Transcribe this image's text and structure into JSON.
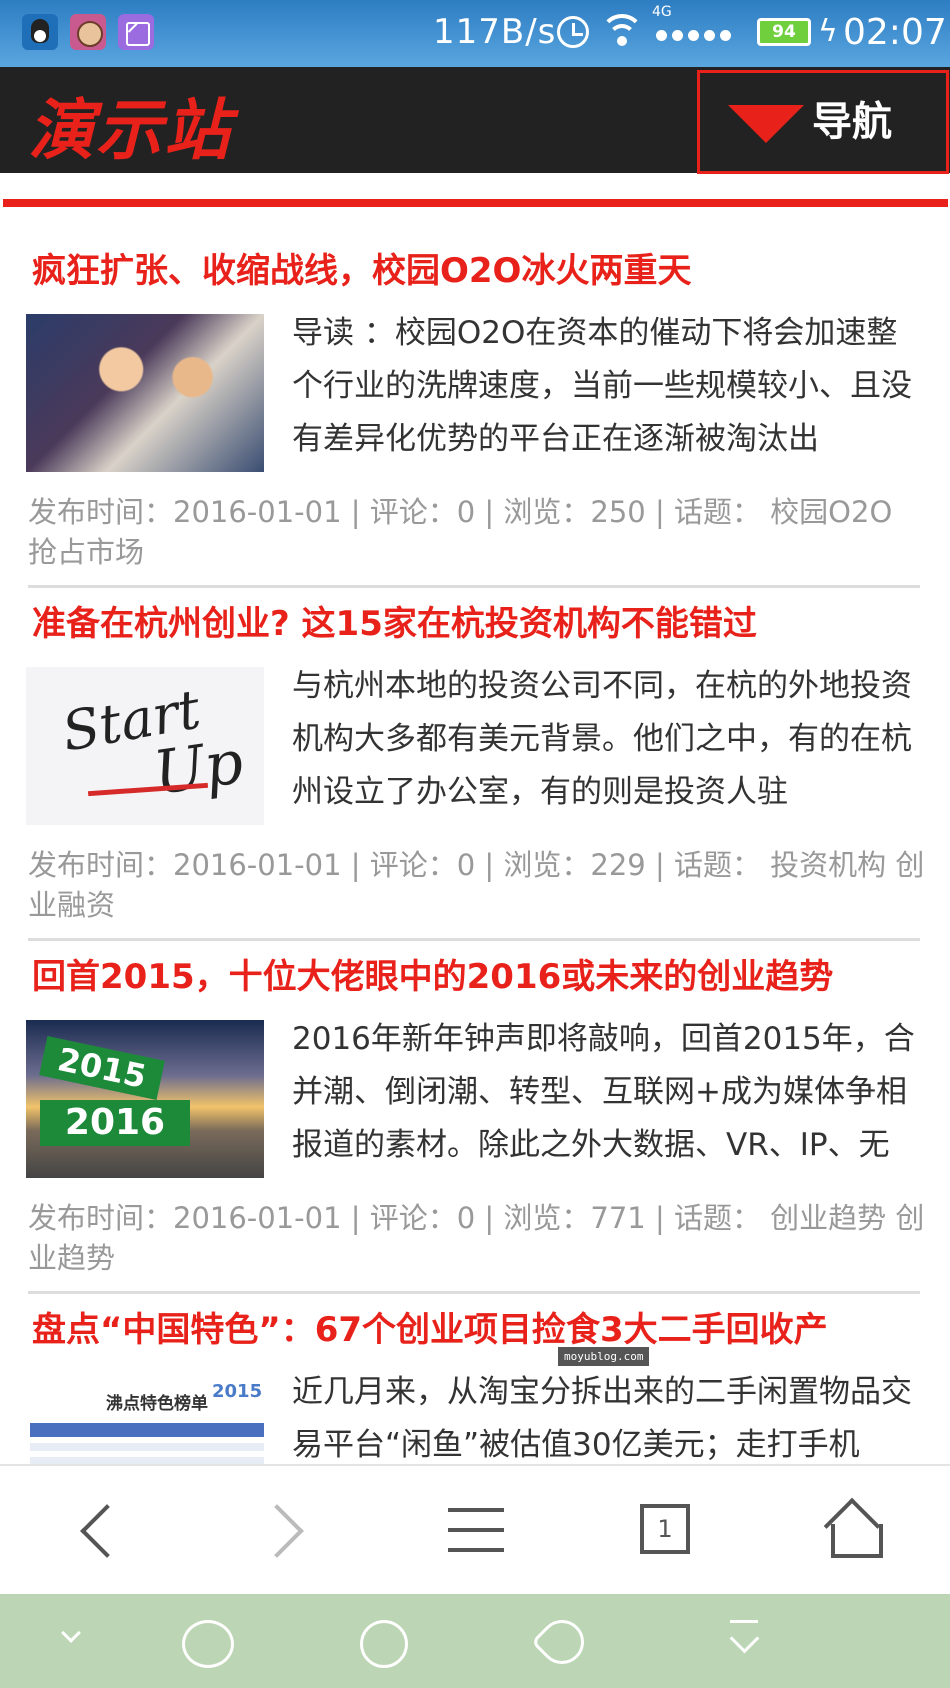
{
  "status_bar": {
    "speed": "117B/s",
    "network": "4G",
    "battery": "94",
    "time": "02:07",
    "icons": [
      "qq-icon",
      "pet-app-icon",
      "gallery-icon",
      "alarm-icon",
      "wifi-icon",
      "signal-icon",
      "battery-icon",
      "charging-icon"
    ]
  },
  "header": {
    "logo": "演示站",
    "nav_label": "导航"
  },
  "articles": [
    {
      "title": "疯狂扩张、收缩战线，校园O2O冰火两重天",
      "excerpt": "导读 ：校园O2O在资本的催动下将会加速整个行业的洗牌速度，当前一些规模较小、且没有差异化优势的平台正在逐渐被淘汰出",
      "meta": "发布时间：2016-01-01 | 评论：0 | 浏览：250 | 话题： 校园O2O    抢占市场"
    },
    {
      "title": "准备在杭州创业? 这15家在杭投资机构不能错过",
      "excerpt": "与杭州本地的投资公司不同，在杭的外地投资机构大多都有美元背景。他们之中，有的在杭州设立了办公室，有的则是投资人驻",
      "meta": "发布时间：2016-01-01 | 评论：0 | 浏览：229 | 话题： 投资机构    创业融资"
    },
    {
      "title": "回首2015，十位大佬眼中的2016或未来的创业趋势",
      "excerpt": "2016年新年钟声即将敲响，回首2015年，合并潮、倒闭潮、转型、互联网+成为媒体争相报道的素材。除此之外大数据、VR、IP、无",
      "meta": "发布时间：2016-01-01 | 评论：0 | 浏览：771 | 话题： 创业趋势    创业趋势"
    },
    {
      "title": "盘点“中国特色”：67个创业项目捡食3大二手回收产",
      "excerpt": "近几月来，从淘宝分拆出来的二手闲置物品交易平台“闲鱼”被估值30亿美元；走打手机",
      "meta": ""
    }
  ],
  "thumbs": {
    "startup_word1": "Start",
    "startup_word2": "Up",
    "sign_2015": "2015",
    "sign_2016": "2016",
    "rank_head": "沸点特色榜单",
    "rank_year": "2015"
  },
  "watermark": "moyublog.com",
  "browser_toolbar": {
    "tab_count": "1"
  }
}
